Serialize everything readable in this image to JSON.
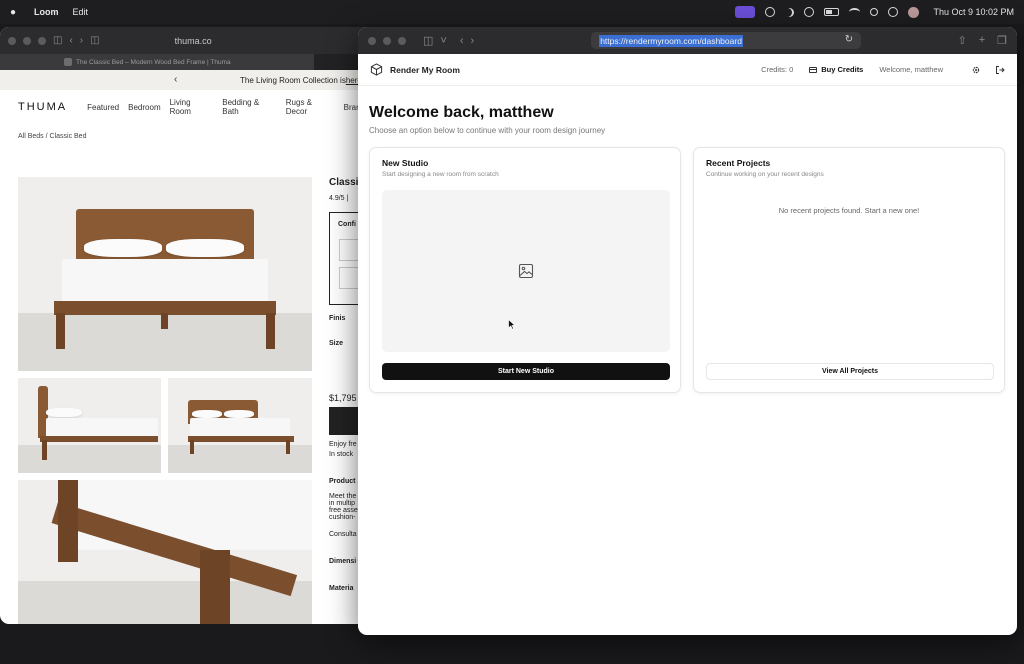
{
  "menubar": {
    "app_name": "Loom",
    "menus": [
      "Edit"
    ],
    "clock": "Thu Oct 9  10:02 PM"
  },
  "bg_browser": {
    "url": "thuma.co",
    "tab_title": "The Classic Bed – Modern Wood Bed Frame | Thuma",
    "promo_text": "The Living Room Collection is ",
    "promo_link": "here.",
    "logo": "THUMA",
    "nav": [
      "Featured",
      "Bedroom",
      "Living Room",
      "Bedding & Bath",
      "Rugs & Decor",
      "Brand"
    ],
    "breadcrumb": "All Beds  /  Classic Bed",
    "product": {
      "title": "Classi",
      "rating": "4.9/5 |",
      "config_label": "Confi",
      "finish_label": "Finis",
      "size_label": "Size",
      "price": "$1,795",
      "note_1": "Enjoy fre",
      "note_2": "In stock",
      "sec_product": "Product",
      "desc_1": "Meet the",
      "desc_2": "in multip",
      "desc_3": "free asse",
      "desc_4": "cushion-",
      "consult": "Consulta",
      "sec_dimensions": "Dimensi",
      "sec_materials": "Materia"
    }
  },
  "fg_browser": {
    "url": "https://rendermyroom.com/dashboard"
  },
  "app": {
    "brand": "Render My Room",
    "credits": "Credits: 0",
    "buy_credits": "Buy Credits",
    "welcome_user": "Welcome, matthew",
    "title": "Welcome back, matthew",
    "subtitle": "Choose an option below to continue with your room design journey",
    "new_studio": {
      "title": "New Studio",
      "subtitle": "Start designing a new room from scratch",
      "button": "Start New Studio"
    },
    "recent": {
      "title": "Recent Projects",
      "subtitle": "Continue working on your recent designs",
      "empty": "No recent projects found. Start a new one!",
      "button": "View All Projects"
    }
  },
  "colors": {
    "primary": "#111111",
    "url_highlight": "#3b6fd4",
    "loom_badge": "#6b4fd8"
  }
}
